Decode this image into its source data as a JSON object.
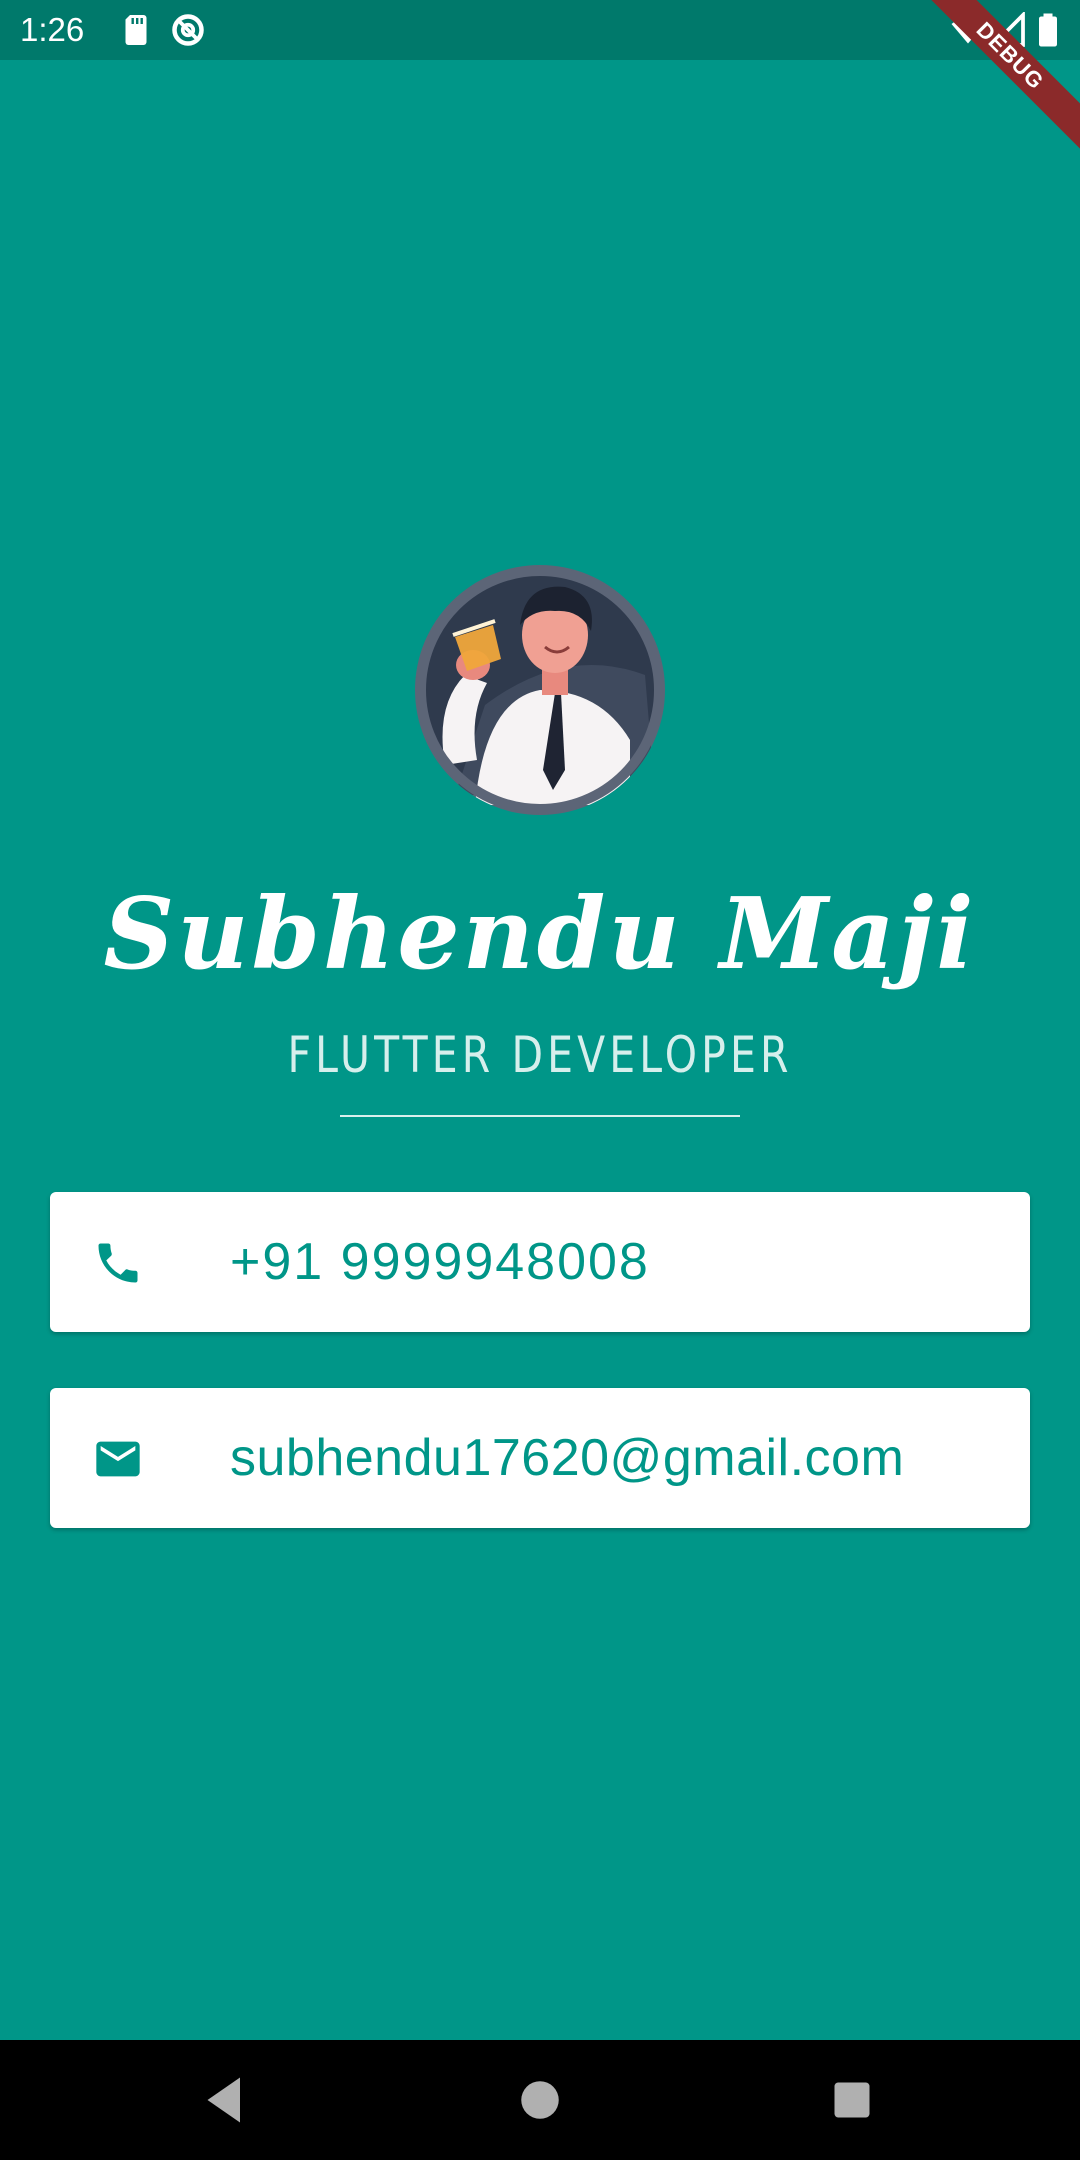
{
  "status_bar": {
    "time": "1:26",
    "icons": [
      "sd-card-icon",
      "data-saver-icon",
      "wifi-icon",
      "signal-icon",
      "battery-icon"
    ]
  },
  "debug_banner": {
    "label": "DEBUG"
  },
  "profile": {
    "avatar": "developer-avatar-illustration",
    "name": "Subhendu Maji",
    "title": "FLUTTER DEVELOPER"
  },
  "contacts": {
    "phone": {
      "icon": "phone-icon",
      "value": "+91 9999948008"
    },
    "email": {
      "icon": "email-icon",
      "value": "subhendu17620@gmail.com"
    }
  },
  "navigation": {
    "buttons": [
      "back-icon",
      "home-icon",
      "recents-icon"
    ]
  },
  "colors": {
    "background": "#009688",
    "status_bar": "#00796b",
    "card": "#ffffff",
    "accent_text": "#009688",
    "debug_ribbon": "#8b2a2a"
  }
}
